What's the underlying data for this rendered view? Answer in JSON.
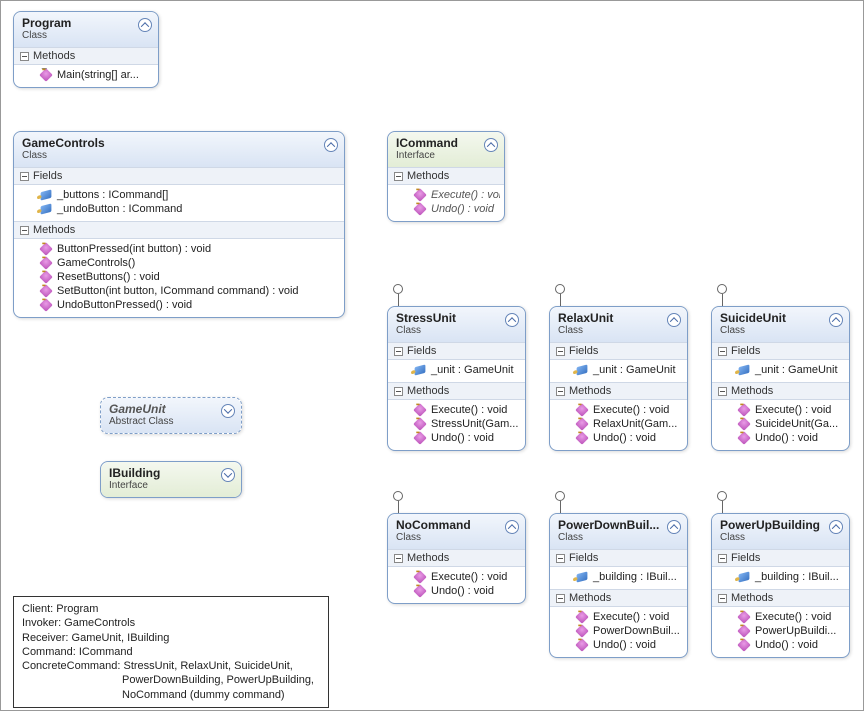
{
  "labels": {
    "fields": "Fields",
    "methods": "Methods",
    "class": "Class",
    "abstract_class": "Abstract Class",
    "interface": "Interface"
  },
  "boxes": {
    "program": {
      "title": "Program",
      "methods": [
        "Main(string[] ar..."
      ]
    },
    "game_controls": {
      "title": "GameControls",
      "fields": [
        "_buttons : ICommand[]",
        "_undoButton : ICommand"
      ],
      "methods": [
        "ButtonPressed(int button) : void",
        "GameControls()",
        "ResetButtons() : void",
        "SetButton(int button, ICommand command) : void",
        "UndoButtonPressed() : void"
      ]
    },
    "icommand": {
      "title": "ICommand",
      "methods": [
        "Execute() : void",
        "Undo() : void"
      ]
    },
    "gameunit": {
      "title": "GameUnit"
    },
    "ibuilding": {
      "title": "IBuilding"
    },
    "stressunit": {
      "title": "StressUnit",
      "fields": [
        "_unit : GameUnit"
      ],
      "methods": [
        "Execute() : void",
        "StressUnit(Gam...",
        "Undo() : void"
      ]
    },
    "relaxunit": {
      "title": "RelaxUnit",
      "fields": [
        "_unit : GameUnit"
      ],
      "methods": [
        "Execute() : void",
        "RelaxUnit(Gam...",
        "Undo() : void"
      ]
    },
    "suicideunit": {
      "title": "SuicideUnit",
      "fields": [
        "_unit : GameUnit"
      ],
      "methods": [
        "Execute() : void",
        "SuicideUnit(Ga...",
        "Undo() : void"
      ]
    },
    "nocommand": {
      "title": "NoCommand",
      "methods": [
        "Execute() : void",
        "Undo() : void"
      ]
    },
    "powerdown": {
      "title": "PowerDownBuil...",
      "fields": [
        "_building : IBuil..."
      ],
      "methods": [
        "Execute() : void",
        "PowerDownBuil...",
        "Undo() : void"
      ]
    },
    "powerup": {
      "title": "PowerUpBuilding",
      "fields": [
        "_building : IBuil..."
      ],
      "methods": [
        "Execute() : void",
        "PowerUpBuildi...",
        "Undo() : void"
      ]
    }
  },
  "note": {
    "l1": "Client: Program",
    "l2": "Invoker: GameControls",
    "l3": "Receiver: GameUnit, IBuilding",
    "l4": "Command: ICommand",
    "l5": "ConcreteCommand: StressUnit, RelaxUnit, SuicideUnit,",
    "l6": "PowerDownBuilding, PowerUpBuilding,",
    "l7": "NoCommand (dummy command)"
  }
}
